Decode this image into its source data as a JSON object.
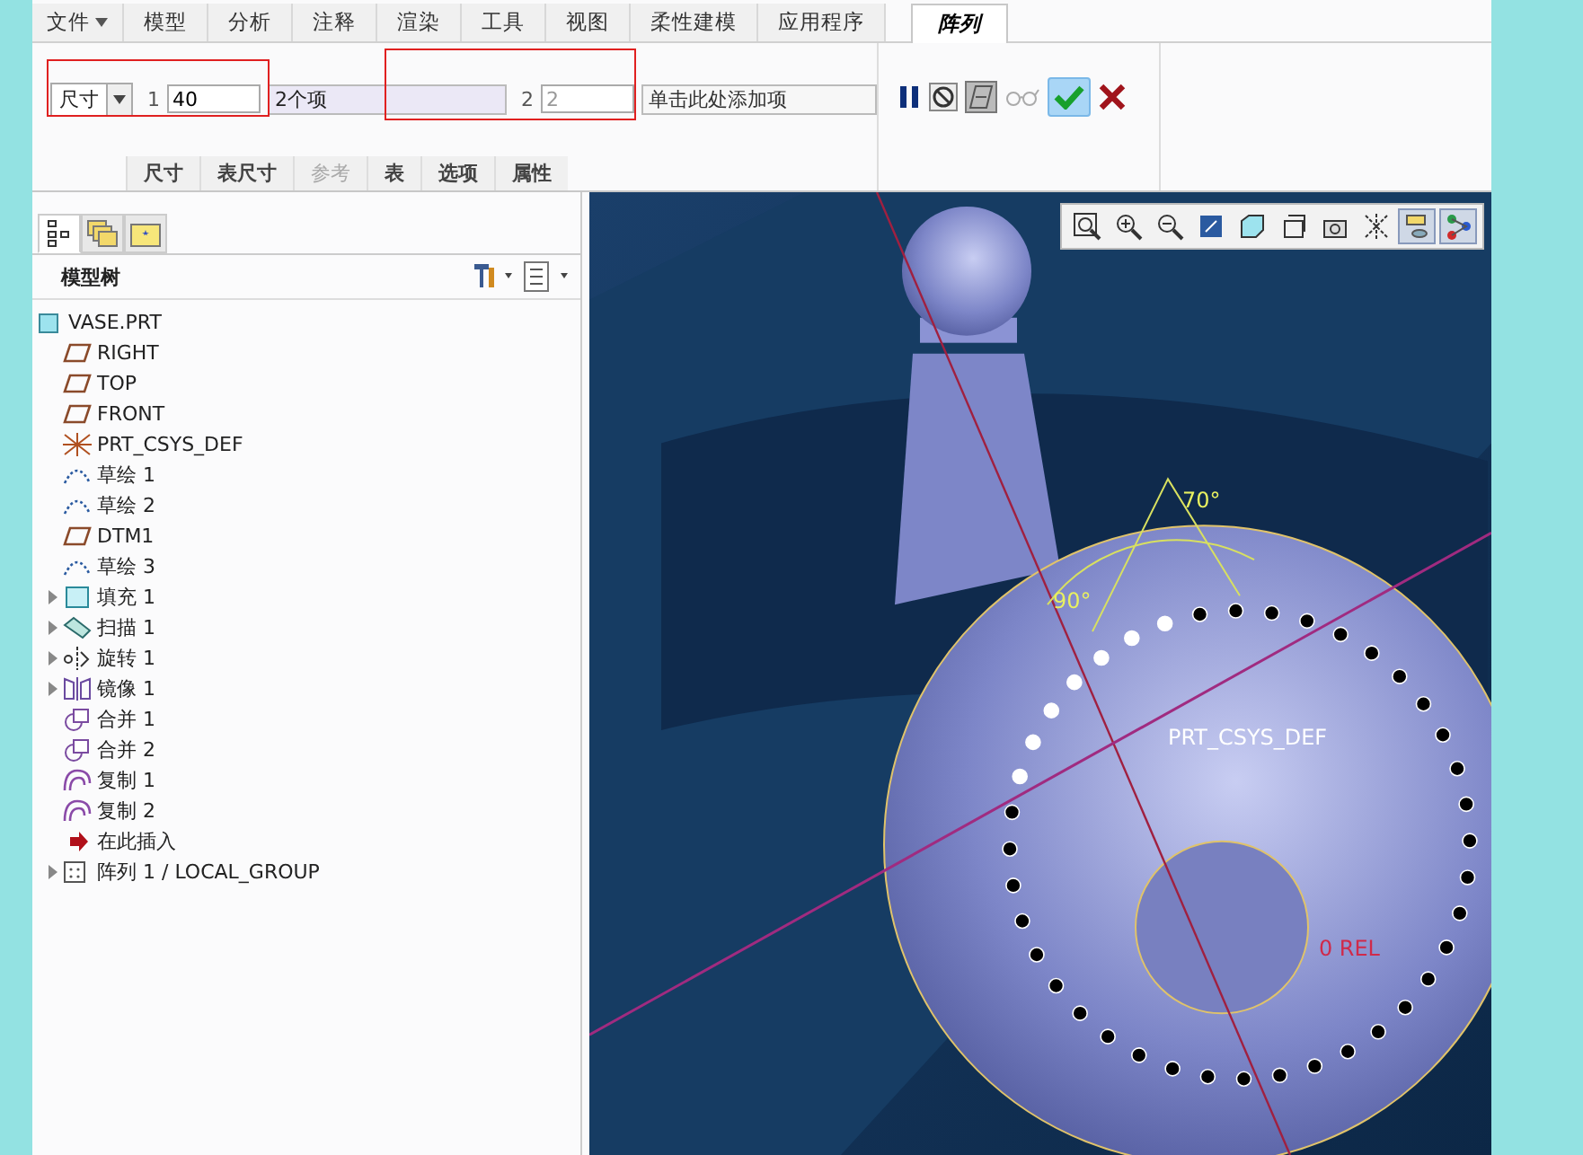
{
  "ribbon_tabs": [
    {
      "label": "文件",
      "kind": "menu"
    },
    {
      "label": "模型",
      "kind": "tab",
      "selected": false
    },
    {
      "label": "分析",
      "kind": "tab",
      "selected": false
    },
    {
      "label": "注释",
      "kind": "tab",
      "selected": false
    },
    {
      "label": "渲染",
      "kind": "tab",
      "selected": false
    },
    {
      "label": "工具",
      "kind": "tab",
      "selected": false
    },
    {
      "label": "视图",
      "kind": "tab",
      "selected": false
    },
    {
      "label": "柔性建模",
      "kind": "tab",
      "selected": false
    },
    {
      "label": "应用程序",
      "kind": "tab",
      "selected": false
    },
    {
      "label": "阵列",
      "kind": "tab",
      "selected": true
    }
  ],
  "dashboard": {
    "pattern_type": "尺寸",
    "direction_1": {
      "index": "1",
      "count": "40",
      "collector": "2个项"
    },
    "direction_2": {
      "index": "2",
      "count": "2",
      "collector": "单击此处添加项"
    }
  },
  "panel_tabs": [
    {
      "label": "尺寸",
      "disabled": false
    },
    {
      "label": "表尺寸",
      "disabled": false
    },
    {
      "label": "参考",
      "disabled": true
    },
    {
      "label": "表",
      "disabled": false
    },
    {
      "label": "选项",
      "disabled": false
    },
    {
      "label": "属性",
      "disabled": false
    }
  ],
  "model_tree": {
    "title": "模型树",
    "root": "VASE.PRT",
    "items": [
      {
        "kind": "plane",
        "label": "RIGHT",
        "expander": false
      },
      {
        "kind": "plane",
        "label": "TOP",
        "expander": false
      },
      {
        "kind": "plane",
        "label": "FRONT",
        "expander": false
      },
      {
        "kind": "csys",
        "label": "PRT_CSYS_DEF",
        "expander": false
      },
      {
        "kind": "sketch",
        "label": "草绘 1",
        "expander": false
      },
      {
        "kind": "sketch",
        "label": "草绘 2",
        "expander": false
      },
      {
        "kind": "plane",
        "label": "DTM1",
        "expander": false
      },
      {
        "kind": "sketch",
        "label": "草绘 3",
        "expander": false
      },
      {
        "kind": "fill",
        "label": "填充 1",
        "expander": true
      },
      {
        "kind": "sweep",
        "label": "扫描 1",
        "expander": true
      },
      {
        "kind": "revolve",
        "label": "旋转 1",
        "expander": true
      },
      {
        "kind": "mirror",
        "label": "镜像 1",
        "expander": true
      },
      {
        "kind": "merge",
        "label": "合并 1",
        "expander": false
      },
      {
        "kind": "merge",
        "label": "合并 2",
        "expander": false
      },
      {
        "kind": "copy",
        "label": "复制 1",
        "expander": false
      },
      {
        "kind": "copy",
        "label": "复制 2",
        "expander": false
      },
      {
        "kind": "insert",
        "label": "在此插入",
        "expander": false
      },
      {
        "kind": "pattern",
        "label": "阵列 1 / LOCAL_GROUP",
        "expander": true
      }
    ]
  },
  "view_toolbar": [
    {
      "pressed": false
    },
    {
      "pressed": false
    },
    {
      "pressed": false
    },
    {
      "pressed": false
    },
    {
      "pressed": false
    },
    {
      "pressed": false
    },
    {
      "pressed": false
    },
    {
      "pressed": false
    },
    {
      "pressed": true
    },
    {
      "pressed": true
    }
  ],
  "viewport": {
    "angle_1": "70°",
    "angle_2": "90°",
    "csys_label": "PRT_CSYS_DEF",
    "reference_label": "0 REL"
  }
}
